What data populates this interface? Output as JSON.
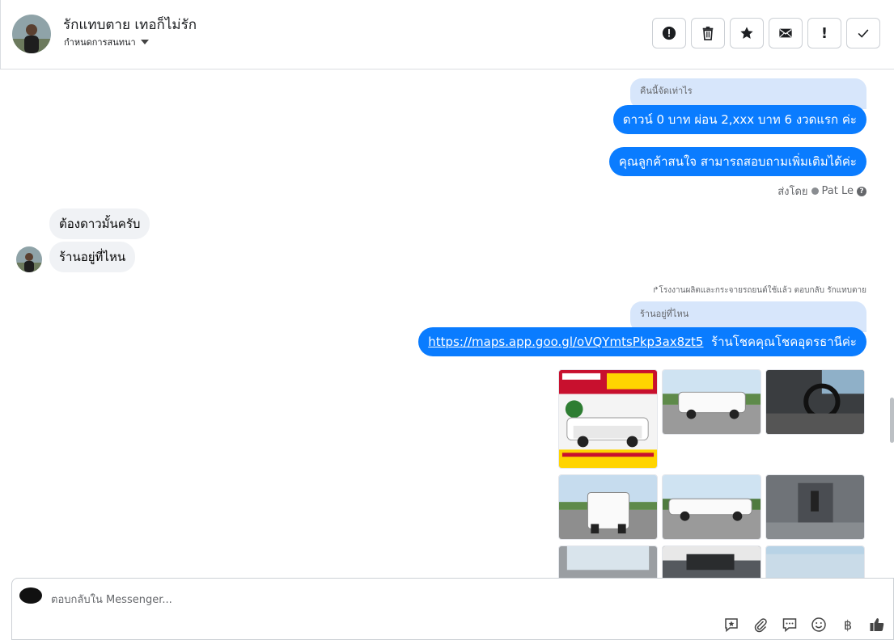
{
  "header": {
    "name": "รักแทบตาย เทอก็ไม่รัก",
    "assign": "กำหนดการสนทนา",
    "actions": [
      "alert-circle-icon",
      "trash-icon",
      "star-icon",
      "envelope-icon",
      "exclamation-icon",
      "check-icon"
    ]
  },
  "messages": {
    "quote1": "คืนนี้จัดเท่าไร",
    "out1": "ดาวน์  0 บาท ผ่อน  2,xxx บาท 6 งวดแรก ค่ะ",
    "out2": "คุณลูกค้าสนใจ สามารถสอบถามเพิ่มเติมได้ค่ะ",
    "sent_by_label": "ส่งโดย",
    "sent_by_name": "Pat Le",
    "in1": "ต้องดาวมั้นครับ",
    "in2": "ร้านอยู่ที่ไหน",
    "reply_note": "โรงงานผลิตและกระจายรถยนต์ใช้แล้ว ตอบกลับ รักแทบตาย",
    "quote2": "ร้านอยู่ที่ไหน",
    "out3_link": "https://maps.app.goo.gl/oVQYmtsPkp3ax8zt5",
    "out3_text": "ร้านโชคคุณโชคอุดรธานีค่ะ"
  },
  "composer": {
    "placeholder": "ตอบกลับใน Messenger...",
    "baht": "฿"
  },
  "colors": {
    "accent": "#0a7cff",
    "quote_bg": "#d7e6fb",
    "incoming_bg": "#f0f2f5"
  }
}
